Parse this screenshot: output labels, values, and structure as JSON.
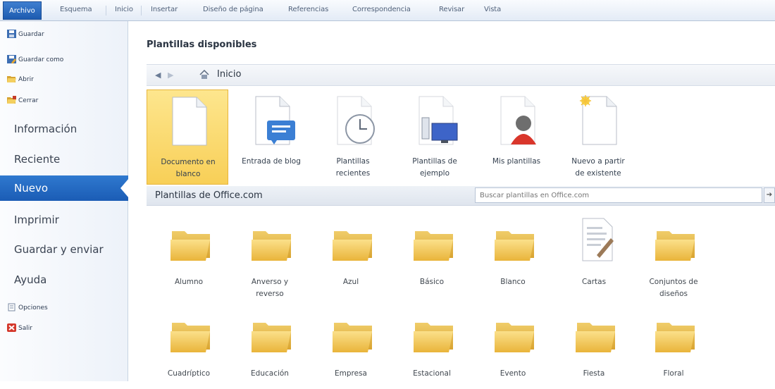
{
  "ribbon": {
    "tabs": [
      {
        "label": "Archivo"
      },
      {
        "label": "Esquema"
      },
      {
        "label": "Inicio"
      },
      {
        "label": "Insertar"
      },
      {
        "label": "Diseño de página"
      },
      {
        "label": "Referencias"
      },
      {
        "label": "Correspondencia"
      },
      {
        "label": "Revisar"
      },
      {
        "label": "Vista"
      }
    ]
  },
  "sidebar": {
    "commands_top": [
      {
        "label": "Guardar",
        "icon": "save-icon"
      },
      {
        "label": "Guardar como",
        "icon": "save-as-icon"
      },
      {
        "label": "Abrir",
        "icon": "open-folder-icon"
      },
      {
        "label": "Cerrar",
        "icon": "close-folder-icon"
      }
    ],
    "nav": [
      {
        "label": "Información"
      },
      {
        "label": "Reciente"
      },
      {
        "label": "Nuevo"
      },
      {
        "label": "Imprimir"
      },
      {
        "label": "Guardar y enviar"
      },
      {
        "label": "Ayuda"
      }
    ],
    "commands_bottom": [
      {
        "label": "Opciones",
        "icon": "options-icon"
      },
      {
        "label": "Salir",
        "icon": "exit-icon"
      }
    ]
  },
  "main": {
    "heading": "Plantillas disponibles",
    "breadcrumb": "Inicio",
    "templates": [
      {
        "label_line1": "Documento en",
        "label_line2": "blanco",
        "icon": "blank-document-icon"
      },
      {
        "label_line1": "Entrada de blog",
        "label_line2": "",
        "icon": "blog-post-icon"
      },
      {
        "label_line1": "Plantillas",
        "label_line2": "recientes",
        "icon": "recent-templates-icon"
      },
      {
        "label_line1": "Plantillas de",
        "label_line2": "ejemplo",
        "icon": "sample-templates-icon"
      },
      {
        "label_line1": "Mis plantillas",
        "label_line2": "",
        "icon": "my-templates-icon"
      },
      {
        "label_line1": "Nuevo a partir",
        "label_line2": "de existente",
        "icon": "new-from-existing-icon"
      }
    ],
    "office_section": {
      "title": "Plantillas de Office.com",
      "search_placeholder": "Buscar plantillas en Office.com"
    },
    "folders_row1": [
      {
        "line1": "Alumno",
        "line2": "",
        "icon": "folder-icon"
      },
      {
        "line1": "Anverso y",
        "line2": "reverso",
        "icon": "folder-icon"
      },
      {
        "line1": "Azul",
        "line2": "",
        "icon": "folder-icon"
      },
      {
        "line1": "Básico",
        "line2": "",
        "icon": "folder-icon"
      },
      {
        "line1": "Blanco",
        "line2": "",
        "icon": "folder-icon"
      },
      {
        "line1": "Cartas",
        "line2": "",
        "icon": "letter-document-icon"
      },
      {
        "line1": "Conjuntos de",
        "line2": "diseños",
        "icon": "folder-icon"
      }
    ],
    "folders_row2": [
      {
        "line1": "Cuadríptico",
        "icon": "folder-icon"
      },
      {
        "line1": "Educación",
        "icon": "folder-icon"
      },
      {
        "line1": "Empresa",
        "icon": "folder-icon"
      },
      {
        "line1": "Estacional",
        "icon": "folder-icon"
      },
      {
        "line1": "Evento",
        "icon": "folder-icon"
      },
      {
        "line1": "Fiesta",
        "icon": "folder-icon"
      },
      {
        "line1": "Floral",
        "icon": "folder-icon"
      }
    ]
  },
  "colors": {
    "accent": "#1d5bb0",
    "selected_tile": "#f8cf57",
    "folder": "#f2c64a"
  }
}
